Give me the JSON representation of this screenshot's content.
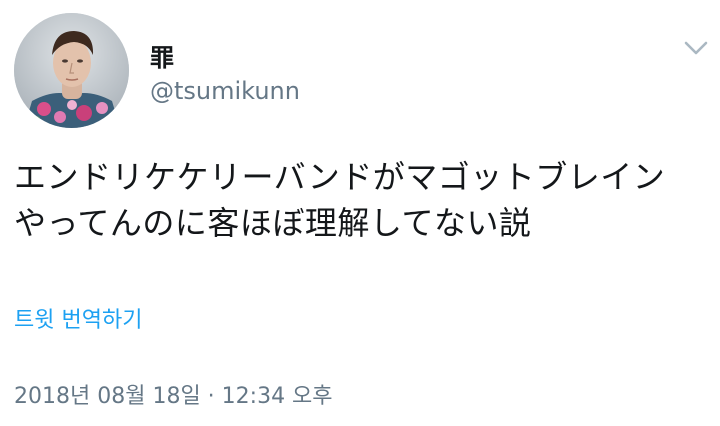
{
  "user": {
    "display_name": "罪",
    "handle": "@tsumikunn",
    "avatar_icon": "profile-avatar-photo"
  },
  "tweet": {
    "text_lines": [
      "エンドリケケリーバンドがマゴットブレイン",
      "やってんのに客ほぼ理解してない説"
    ],
    "translate_label": "트윗 번역하기",
    "timestamp": "2018년 08월 18일 · 12:34 오후"
  },
  "icons": {
    "menu": "chevron-down-icon"
  },
  "colors": {
    "text_primary": "#14171a",
    "text_secondary": "#657786",
    "link": "#1da1f2",
    "chevron": "#aab8c2"
  }
}
